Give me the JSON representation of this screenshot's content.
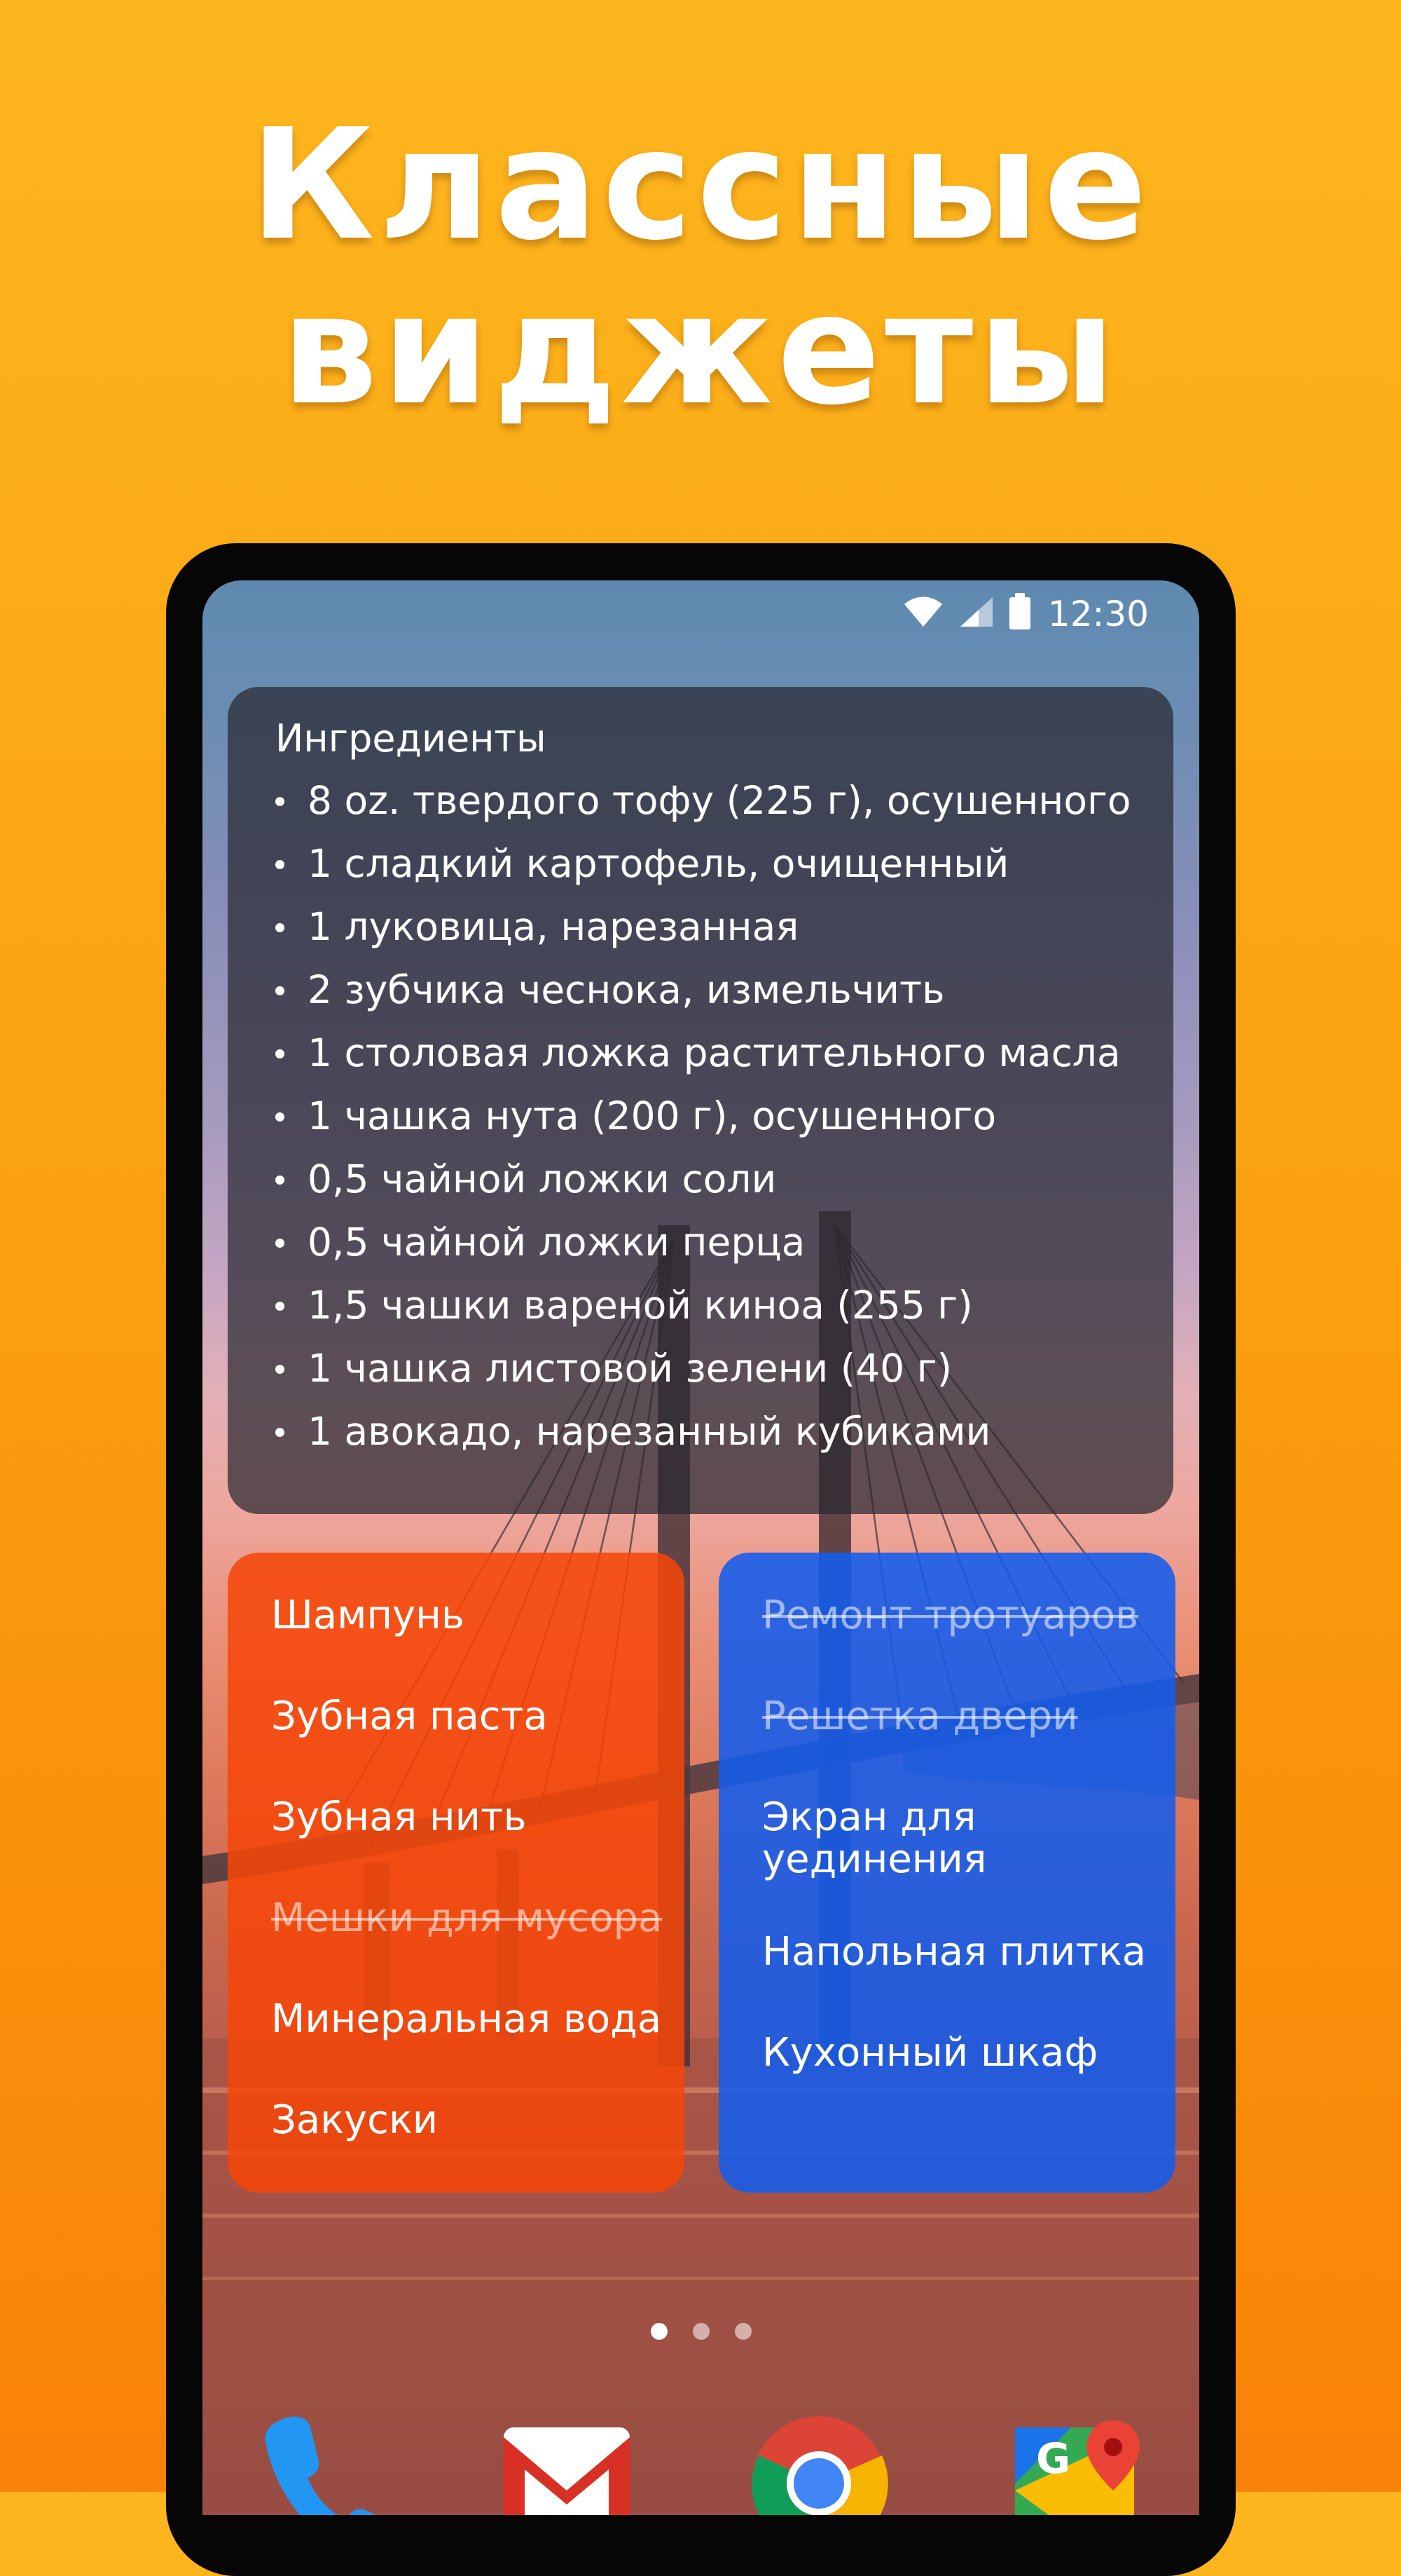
{
  "headline": {
    "line1": "Классные",
    "line2": "виджеты"
  },
  "status_bar": {
    "time": "12:30",
    "icons": [
      "wifi-icon",
      "signal-icon",
      "battery-icon"
    ]
  },
  "ingredients_widget": {
    "title": "Ингредиенты",
    "items": [
      "8 oz. твердого тофу (225 г), осушенного",
      "1 сладкий картофель, очищенный",
      "1 луковица, нарезанная",
      "2 зубчика чеснока, измельчить",
      "1 столовая ложка растительного масла",
      "1 чашка нута (200 г), осушенного",
      "0,5 чайной ложки соли",
      "0,5 чайной ложки перца",
      "1,5 чашки вареной киноа (255 г)",
      "1 чашка листовой зелени (40 г)",
      "1 авокадо, нарезанный кубиками"
    ]
  },
  "shopping_widget": {
    "color": "#F64608",
    "items": [
      {
        "label": "Шампунь",
        "done": false
      },
      {
        "label": "Зубная паста",
        "done": false
      },
      {
        "label": "Зубная нить",
        "done": false
      },
      {
        "label": "Мешки для мусора",
        "done": true
      },
      {
        "label": "Минеральная вода",
        "done": false
      },
      {
        "label": "Закуски",
        "done": false
      }
    ]
  },
  "repair_widget": {
    "color": "#125CEE",
    "items": [
      {
        "label": "Ремонт тротуаров",
        "done": true
      },
      {
        "label": "Решетка двери",
        "done": true
      },
      {
        "label": "Экран для уединения",
        "done": false
      },
      {
        "label": "Напольная плитка",
        "done": false
      },
      {
        "label": "Кухонный шкаф",
        "done": false
      }
    ]
  },
  "home_screen": {
    "page_count": 3,
    "active_page": 1
  },
  "dock": [
    "phone-icon",
    "gmail-icon",
    "chrome-icon",
    "google-maps-icon"
  ],
  "colors": {
    "background": "#FBA010",
    "headline": "#FFFFFF",
    "orange_widget": "#F64608",
    "blue_widget": "#125CEE"
  }
}
